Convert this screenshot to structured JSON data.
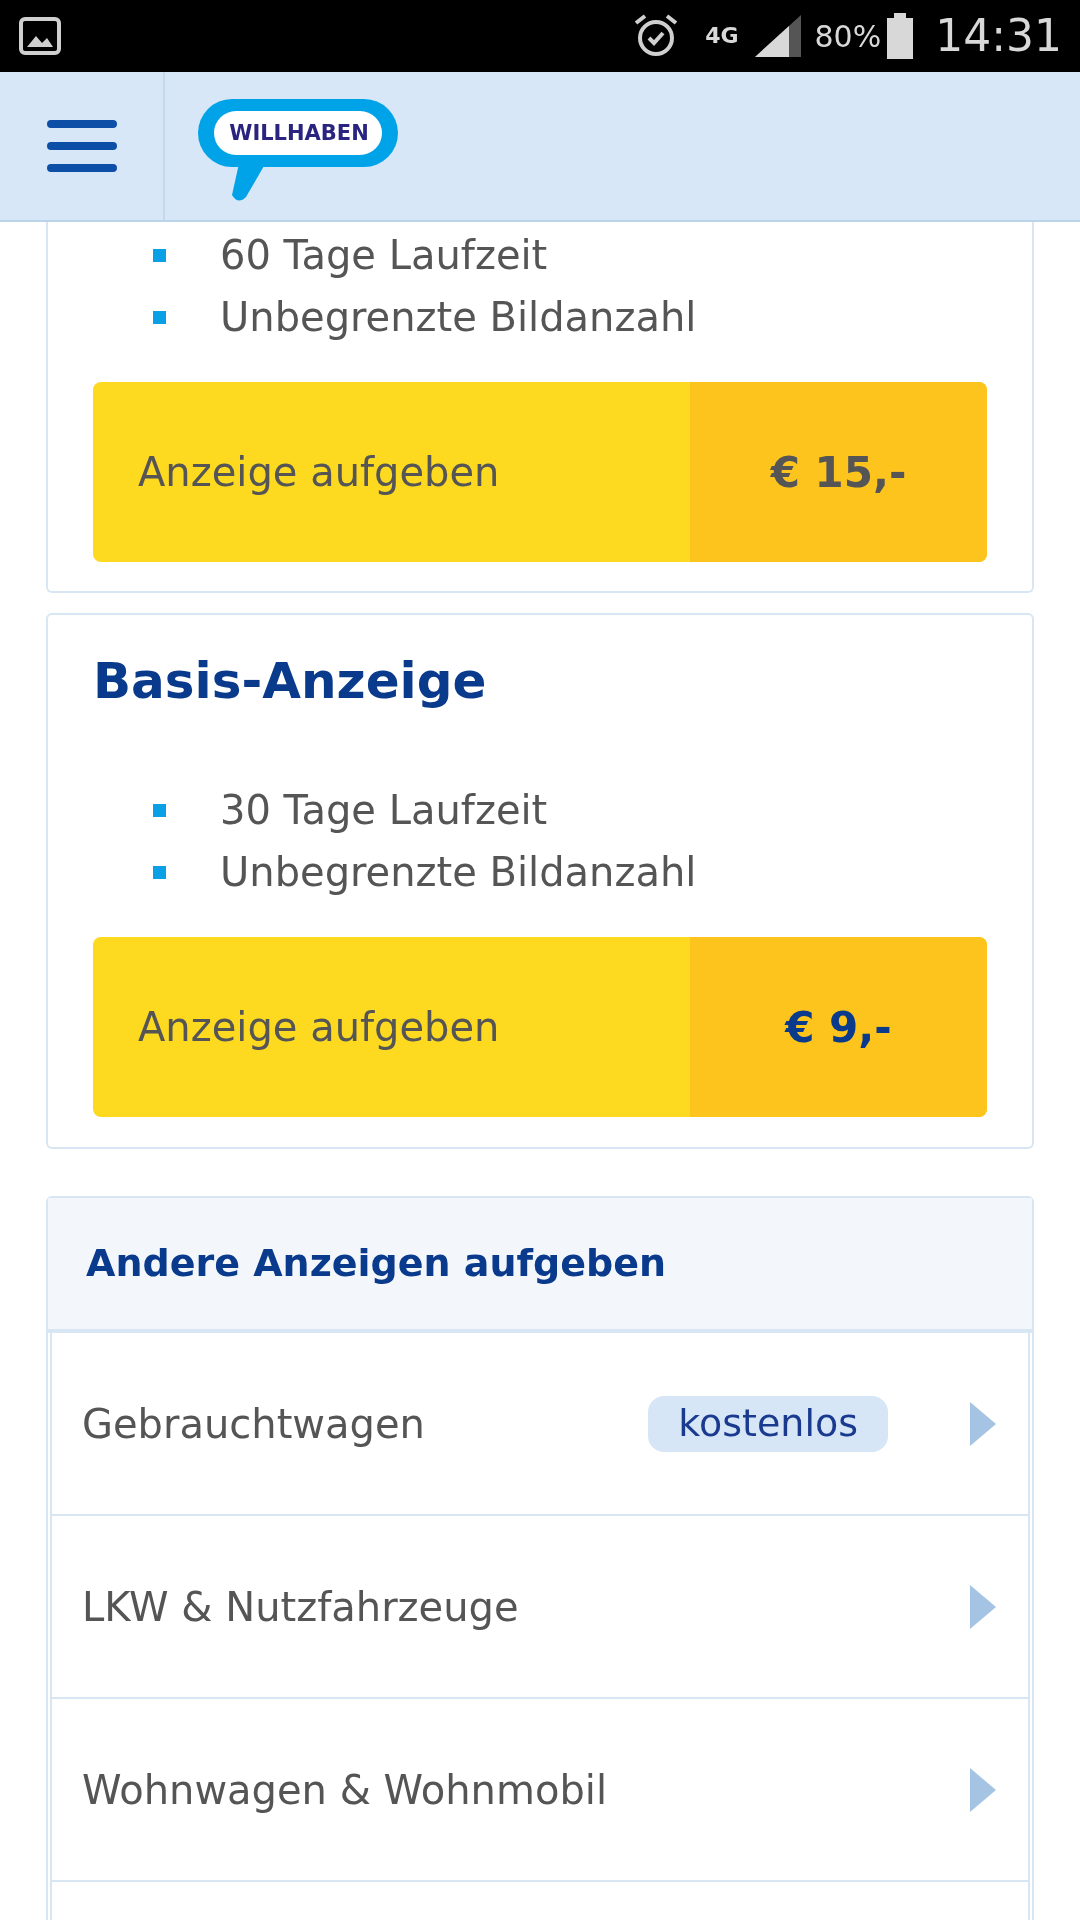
{
  "status_bar": {
    "network": "4G",
    "battery": "80%",
    "time": "14:31"
  },
  "header": {
    "logo": "WILLHABEN"
  },
  "plans": [
    {
      "features": [
        "60 Tage Laufzeit",
        "Unbegrenzte Bildanzahl"
      ],
      "button_label": "Anzeige aufgeben",
      "price": "€ 15,-",
      "price_highlighted": false
    },
    {
      "title": "Basis-Anzeige",
      "features": [
        "30 Tage Laufzeit",
        "Unbegrenzte Bildanzahl"
      ],
      "button_label": "Anzeige aufgeben",
      "price": "€ 9,-",
      "price_highlighted": true
    }
  ],
  "other_ads": {
    "title": "Andere Anzeigen aufgeben",
    "items": [
      {
        "label": "Gebrauchtwagen",
        "badge": "kostenlos"
      },
      {
        "label": "LKW & Nutzfahrzeuge"
      },
      {
        "label": "Wohnwagen & Wohnmobil"
      }
    ]
  }
}
